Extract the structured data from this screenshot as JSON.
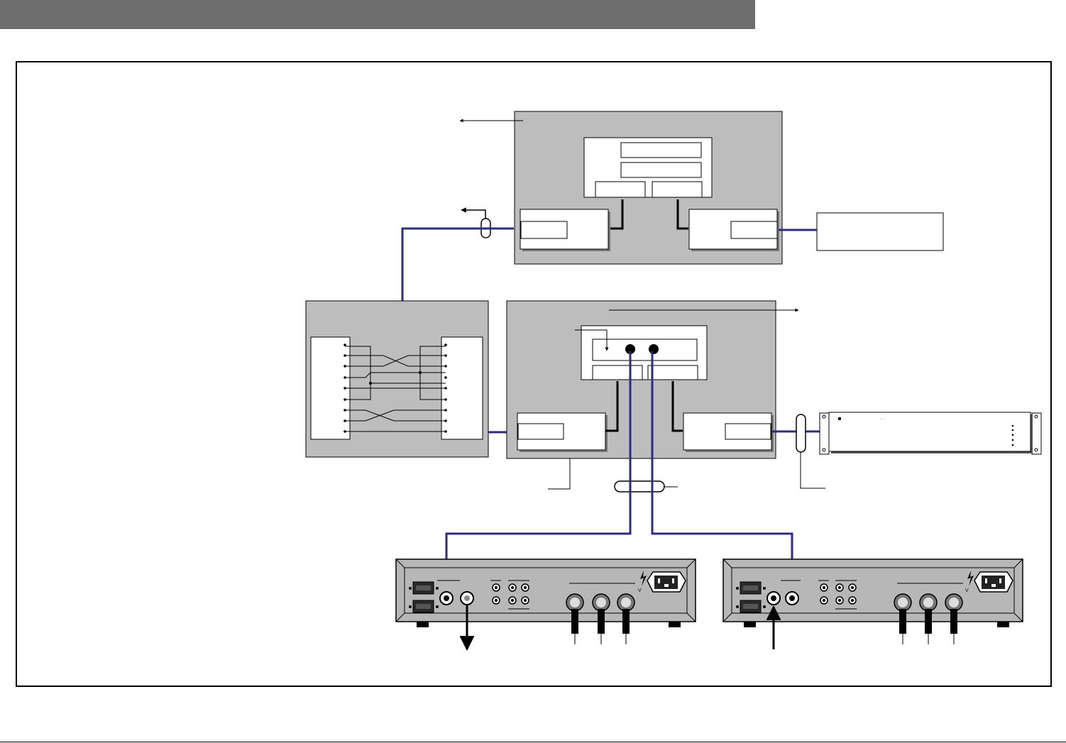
{
  "header": {
    "title": ""
  },
  "diagram": {
    "colors": {
      "cable": "#2b2b8a",
      "panel_fill": "#bdbdbd",
      "device_fill": "#b7b7b7",
      "box_fill": "#ffffff",
      "outline": "#000000"
    },
    "icons": [
      "arrow-icon",
      "cable-tie-icon",
      "rack-unit-icon",
      "xlr-connector-icon",
      "power-inlet-icon",
      "warning-bolt-icon"
    ]
  }
}
